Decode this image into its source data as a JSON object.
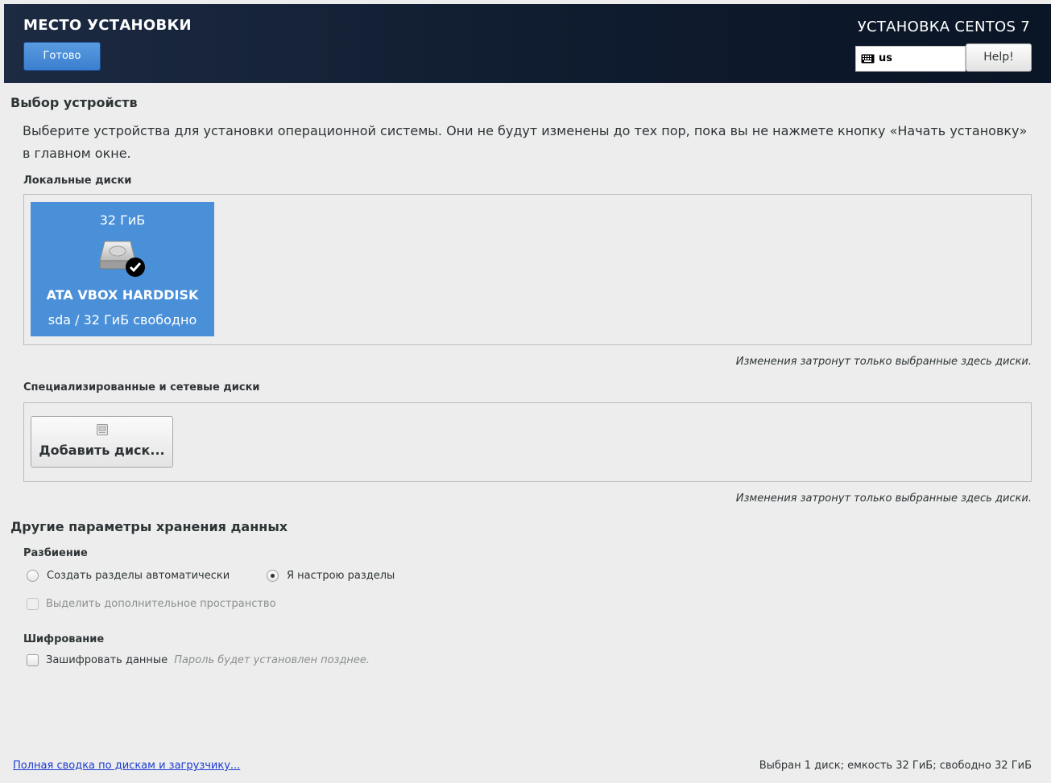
{
  "header": {
    "title": "МЕСТО УСТАНОВКИ",
    "done_label": "Готово",
    "product": "УСТАНОВКА CENTOS 7",
    "keyboard_layout": "us",
    "help_label": "Help!"
  },
  "device_selection": {
    "heading": "Выбор устройств",
    "description": "Выберите устройства для установки операционной системы. Они не будут изменены до тех пор, пока вы не нажмете кнопку «Начать установку» в главном окне.",
    "local_disks": {
      "heading": "Локальные диски",
      "disks": [
        {
          "size": "32 ГиБ",
          "name": "ATA VBOX HARDDISK",
          "details": "sda / 32 ГиБ свободно",
          "selected": true,
          "icon": "harddisk-checked-icon"
        }
      ],
      "note": "Изменения затронут только выбранные здесь диски."
    },
    "specialized_disks": {
      "heading": "Специализированные и сетевые диски",
      "add_label": "Добавить диск...",
      "note": "Изменения затронут только выбранные здесь диски."
    }
  },
  "other_storage": {
    "heading": "Другие параметры хранения данных",
    "partitioning": {
      "heading": "Разбиение",
      "auto_label": "Создать разделы автоматически",
      "manual_label": "Я настрою разделы",
      "selected": "manual",
      "extra_space_label": "Выделить дополнительное пространство"
    },
    "encryption": {
      "heading": "Шифрование",
      "encrypt_label": "Зашифровать данные",
      "encrypt_hint": "Пароль будет установлен позднее."
    }
  },
  "footer": {
    "summary_link": "Полная сводка по дискам и загрузчику...",
    "status": "Выбран 1 диск; емкость 32 ГиБ; свободно 32 ГиБ"
  },
  "colors": {
    "header_bg": "#0f1b2e",
    "accent": "#4a90d9",
    "page_bg": "#ededed",
    "link": "#1c3bd4"
  }
}
